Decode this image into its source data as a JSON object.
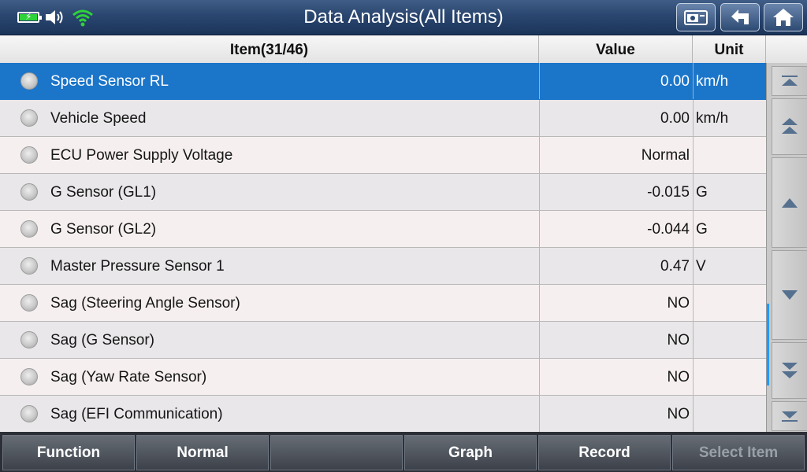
{
  "header": {
    "title": "Data Analysis(All Items)",
    "buttons": [
      "screenshot-camera",
      "back-arrow",
      "home"
    ]
  },
  "status": {
    "battery": "charging",
    "volume": "on",
    "wifi": "connected"
  },
  "table": {
    "columns": {
      "item": "Item(31/46)",
      "value": "Value",
      "unit": "Unit"
    },
    "rows": [
      {
        "name": "Speed Sensor RL",
        "value": "0.00",
        "unit": "km/h",
        "selected": true
      },
      {
        "name": "Vehicle Speed",
        "value": "0.00",
        "unit": "km/h"
      },
      {
        "name": "ECU Power Supply Voltage",
        "value": "Normal",
        "unit": ""
      },
      {
        "name": "G Sensor (GL1)",
        "value": "-0.015",
        "unit": "G"
      },
      {
        "name": "G Sensor (GL2)",
        "value": "-0.044",
        "unit": "G"
      },
      {
        "name": "Master Pressure Sensor 1",
        "value": "0.47",
        "unit": "V"
      },
      {
        "name": "Sag (Steering Angle Sensor)",
        "value": "NO",
        "unit": ""
      },
      {
        "name": "Sag (G Sensor)",
        "value": "NO",
        "unit": ""
      },
      {
        "name": "Sag (Yaw Rate Sensor)",
        "value": "NO",
        "unit": ""
      },
      {
        "name": "Sag (EFI Communication)",
        "value": "NO",
        "unit": ""
      }
    ]
  },
  "scroll_buttons": [
    "scroll-to-top",
    "page-up",
    "line-up",
    "line-down",
    "page-down",
    "scroll-to-bottom"
  ],
  "footer": {
    "function_label": "Function",
    "normal_label": "Normal",
    "empty_label": "",
    "graph_label": "Graph",
    "record_label": "Record",
    "select_item_label": "Select Item"
  },
  "colors": {
    "selected_row": "#1b75c9",
    "scroll_indicator": "#1f9bff",
    "wifi": "#2fd23a"
  }
}
